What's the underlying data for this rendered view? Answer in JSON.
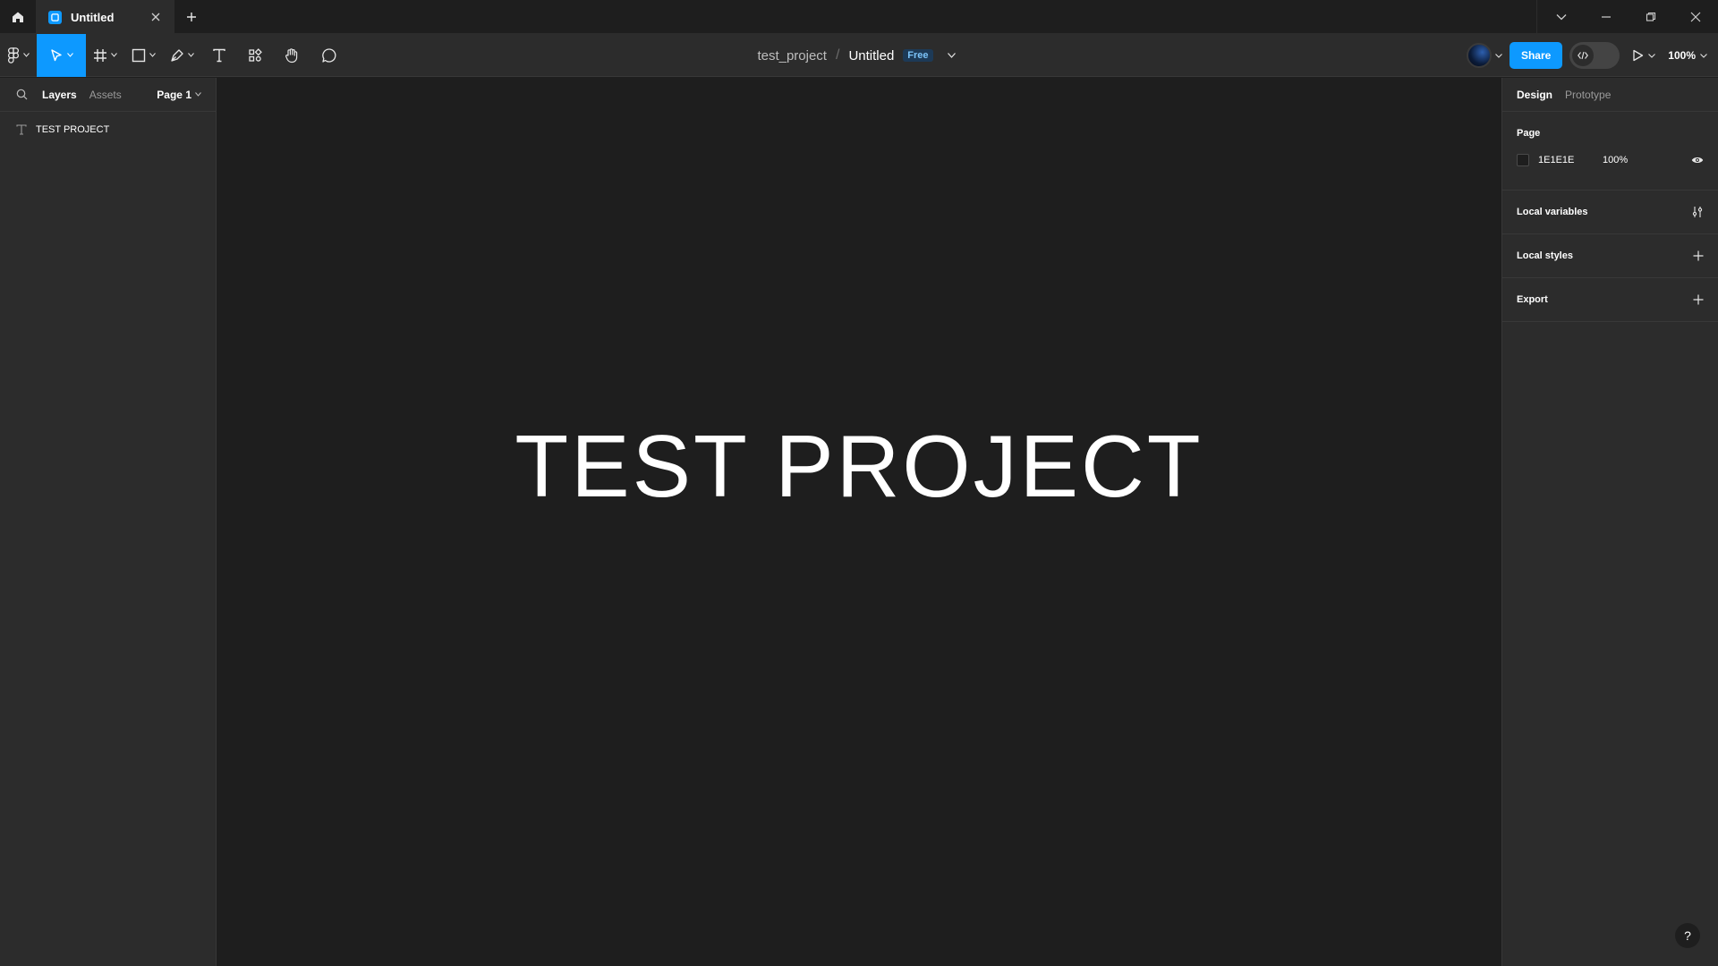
{
  "titlebar": {
    "tab_title": "Untitled",
    "window_controls": [
      "chevron-down-icon",
      "minimize-icon",
      "restore-icon",
      "close-icon"
    ]
  },
  "toolbar": {
    "tools": [
      "main-menu",
      "move",
      "frame",
      "shape",
      "pen",
      "text",
      "resources",
      "hand",
      "comment"
    ],
    "active_tool": "move",
    "project_name": "test_project",
    "separator": "/",
    "file_name": "Untitled",
    "plan_badge": "Free",
    "share_label": "Share",
    "zoom_label": "100%"
  },
  "left_panel": {
    "tabs": [
      {
        "label": "Layers",
        "active": true
      },
      {
        "label": "Assets",
        "active": false
      }
    ],
    "page_label": "Page 1",
    "layers": [
      {
        "type": "text",
        "name": "TEST PROJECT"
      }
    ]
  },
  "canvas": {
    "text": "TEST PROJECT"
  },
  "right_panel": {
    "tabs": [
      {
        "label": "Design",
        "active": true
      },
      {
        "label": "Prototype",
        "active": false
      }
    ],
    "page_section": {
      "title": "Page",
      "fill_hex": "1E1E1E",
      "fill_opacity": "100%"
    },
    "sections": [
      {
        "title": "Local variables",
        "action_icon": "variables-adjust-icon"
      },
      {
        "title": "Local styles",
        "action_icon": "plus-icon"
      },
      {
        "title": "Export",
        "action_icon": "plus-icon"
      }
    ]
  },
  "help_label": "?",
  "colors": {
    "accent": "#0d99ff",
    "panel_bg": "#2c2c2c",
    "canvas_bg": "#1e1e1e"
  }
}
